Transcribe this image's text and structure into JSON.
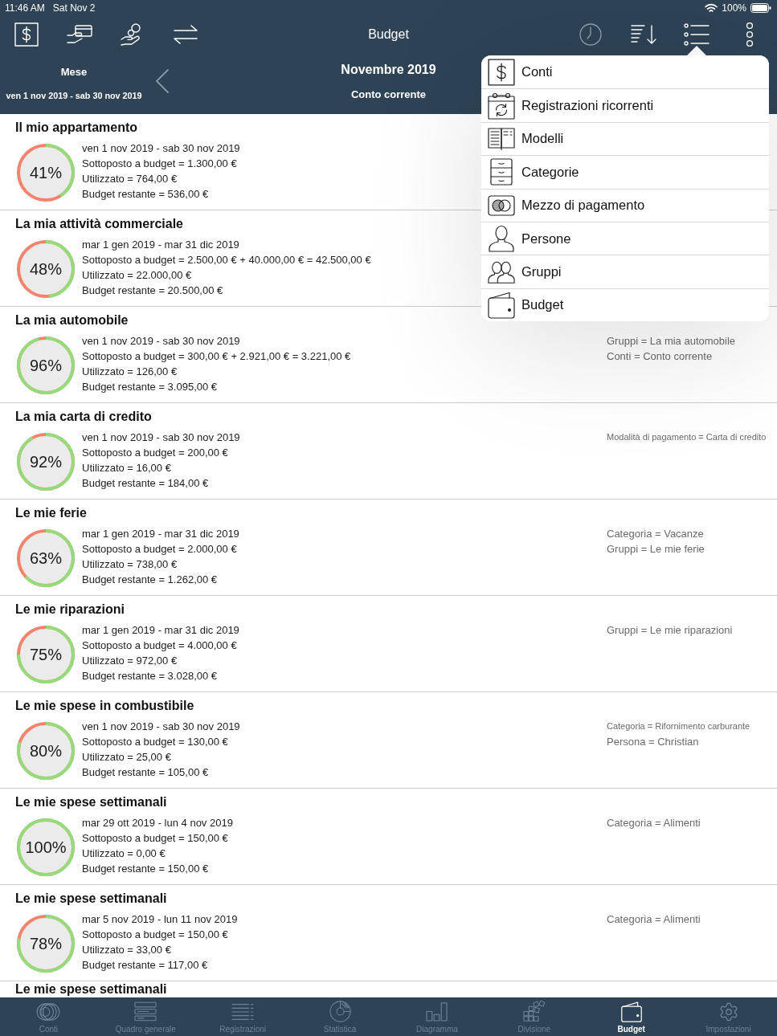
{
  "status_bar": {
    "time": "11:46 AM",
    "date": "Sat Nov 2",
    "battery": "100%"
  },
  "toolbar": {
    "title": "Budget"
  },
  "period": {
    "label": "Mese",
    "range": "ven 1 nov 2019 - sab 30 nov 2019",
    "month": "Novembre 2019",
    "account": "Conto corrente"
  },
  "menu": {
    "items": [
      {
        "label": "Conti"
      },
      {
        "label": "Registrazioni ricorrenti"
      },
      {
        "label": "Modelli"
      },
      {
        "label": "Categorie"
      },
      {
        "label": "Mezzo di pagamento"
      },
      {
        "label": "Persone"
      },
      {
        "label": "Gruppi"
      },
      {
        "label": "Budget"
      }
    ]
  },
  "budgets": [
    {
      "title": "Il mio appartamento",
      "percent": "41%",
      "lines": [
        "ven 1 nov 2019 - sab 30 nov 2019",
        "Sottoposto a budget = 1.300,00 €",
        "Utilizzato = 764,00 €",
        "Budget restante = 536,00 €"
      ]
    },
    {
      "title": "La mia attività commerciale",
      "percent": "48%",
      "lines": [
        "mar 1 gen 2019 - mar 31 dic 2019",
        "Sottoposto a budget = 2.500,00 € + 40.000,00 € = 42.500,00 €",
        "Utilizzato = 22.000,00 €",
        "Budget restante = 20.500,00 €"
      ]
    },
    {
      "title": "La mia automobile",
      "percent": "96%",
      "lines": [
        "ven 1 nov 2019 - sab 30 nov 2019",
        "Sottoposto a budget = 300,00 € + 2.921,00 € = 3.221,00 €",
        "Utilizzato = 126,00 €",
        "Budget restante = 3.095,00 €"
      ],
      "filters": [
        "Gruppi = La mia automobile",
        "Conti = Conto corrente"
      ]
    },
    {
      "title": "La mia carta di credito",
      "percent": "92%",
      "lines": [
        "ven 1 nov 2019 - sab 30 nov 2019",
        "Sottoposto a budget = 200,00 €",
        "Utilizzato = 16,00 €",
        "Budget restante = 184,00 €"
      ],
      "filters": [
        "Modalità di pagamento = Carta di credito"
      ]
    },
    {
      "title": "Le mie ferie",
      "percent": "63%",
      "lines": [
        "mar 1 gen 2019 - mar 31 dic 2019",
        "Sottoposto a budget = 2.000,00 €",
        "Utilizzato = 738,00 €",
        "Budget restante = 1.262,00 €"
      ],
      "filters": [
        "Categoria = Vacanze",
        "Gruppi = Le mie ferie"
      ]
    },
    {
      "title": "Le mie riparazioni",
      "percent": "75%",
      "lines": [
        "mar 1 gen 2019 - mar 31 dic 2019",
        "Sottoposto a budget = 4.000,00 €",
        "Utilizzato = 972,00 €",
        "Budget restante = 3.028,00 €"
      ],
      "filters": [
        "Gruppi = Le mie riparazioni"
      ]
    },
    {
      "title": "Le mie spese in combustibile",
      "percent": "80%",
      "lines": [
        "ven 1 nov 2019 - sab 30 nov 2019",
        "Sottoposto a budget = 130,00 €",
        "Utilizzato = 25,00 €",
        "Budget restante = 105,00 €"
      ],
      "filters": [
        "Categoria = Rifornimento carburante",
        "Persona = Christian"
      ]
    },
    {
      "title": "Le mie spese settimanali",
      "percent": "100%",
      "lines": [
        "mar 29 ott 2019 - lun 4 nov 2019",
        "Sottoposto a budget = 150,00 €",
        "Utilizzato = 0,00 €",
        "Budget restante = 150,00 €"
      ],
      "filters": [
        "Categoria = Alimenti"
      ]
    },
    {
      "title": "Le mie spese settimanali",
      "percent": "78%",
      "lines": [
        "mar 5 nov 2019 - lun 11 nov 2019",
        "Sottoposto a budget = 150,00 €",
        "Utilizzato = 33,00 €",
        "Budget restante = 117,00 €"
      ],
      "filters": [
        "Categoria = Alimenti"
      ]
    },
    {
      "title": "Le mie spese settimanali"
    }
  ],
  "tabs": [
    {
      "label": "Conti",
      "selected": false
    },
    {
      "label": "Quadro generale",
      "selected": false
    },
    {
      "label": "Registrazioni",
      "selected": false
    },
    {
      "label": "Statistica",
      "selected": false
    },
    {
      "label": "Diagramma",
      "selected": false
    },
    {
      "label": "Divisione",
      "selected": false
    },
    {
      "label": "Budget",
      "selected": true
    },
    {
      "label": "Impostazioni",
      "selected": false
    }
  ]
}
